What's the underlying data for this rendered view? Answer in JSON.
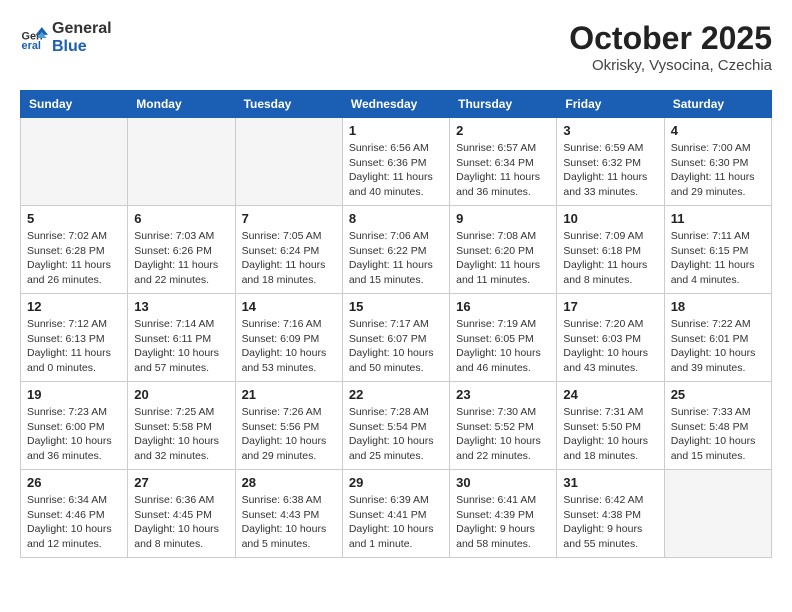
{
  "header": {
    "logo_line1": "General",
    "logo_line2": "Blue",
    "month": "October 2025",
    "location": "Okrisky, Vysocina, Czechia"
  },
  "weekdays": [
    "Sunday",
    "Monday",
    "Tuesday",
    "Wednesday",
    "Thursday",
    "Friday",
    "Saturday"
  ],
  "weeks": [
    [
      {
        "day": "",
        "info": ""
      },
      {
        "day": "",
        "info": ""
      },
      {
        "day": "",
        "info": ""
      },
      {
        "day": "1",
        "info": "Sunrise: 6:56 AM\nSunset: 6:36 PM\nDaylight: 11 hours and 40 minutes."
      },
      {
        "day": "2",
        "info": "Sunrise: 6:57 AM\nSunset: 6:34 PM\nDaylight: 11 hours and 36 minutes."
      },
      {
        "day": "3",
        "info": "Sunrise: 6:59 AM\nSunset: 6:32 PM\nDaylight: 11 hours and 33 minutes."
      },
      {
        "day": "4",
        "info": "Sunrise: 7:00 AM\nSunset: 6:30 PM\nDaylight: 11 hours and 29 minutes."
      }
    ],
    [
      {
        "day": "5",
        "info": "Sunrise: 7:02 AM\nSunset: 6:28 PM\nDaylight: 11 hours and 26 minutes."
      },
      {
        "day": "6",
        "info": "Sunrise: 7:03 AM\nSunset: 6:26 PM\nDaylight: 11 hours and 22 minutes."
      },
      {
        "day": "7",
        "info": "Sunrise: 7:05 AM\nSunset: 6:24 PM\nDaylight: 11 hours and 18 minutes."
      },
      {
        "day": "8",
        "info": "Sunrise: 7:06 AM\nSunset: 6:22 PM\nDaylight: 11 hours and 15 minutes."
      },
      {
        "day": "9",
        "info": "Sunrise: 7:08 AM\nSunset: 6:20 PM\nDaylight: 11 hours and 11 minutes."
      },
      {
        "day": "10",
        "info": "Sunrise: 7:09 AM\nSunset: 6:18 PM\nDaylight: 11 hours and 8 minutes."
      },
      {
        "day": "11",
        "info": "Sunrise: 7:11 AM\nSunset: 6:15 PM\nDaylight: 11 hours and 4 minutes."
      }
    ],
    [
      {
        "day": "12",
        "info": "Sunrise: 7:12 AM\nSunset: 6:13 PM\nDaylight: 11 hours and 0 minutes."
      },
      {
        "day": "13",
        "info": "Sunrise: 7:14 AM\nSunset: 6:11 PM\nDaylight: 10 hours and 57 minutes."
      },
      {
        "day": "14",
        "info": "Sunrise: 7:16 AM\nSunset: 6:09 PM\nDaylight: 10 hours and 53 minutes."
      },
      {
        "day": "15",
        "info": "Sunrise: 7:17 AM\nSunset: 6:07 PM\nDaylight: 10 hours and 50 minutes."
      },
      {
        "day": "16",
        "info": "Sunrise: 7:19 AM\nSunset: 6:05 PM\nDaylight: 10 hours and 46 minutes."
      },
      {
        "day": "17",
        "info": "Sunrise: 7:20 AM\nSunset: 6:03 PM\nDaylight: 10 hours and 43 minutes."
      },
      {
        "day": "18",
        "info": "Sunrise: 7:22 AM\nSunset: 6:01 PM\nDaylight: 10 hours and 39 minutes."
      }
    ],
    [
      {
        "day": "19",
        "info": "Sunrise: 7:23 AM\nSunset: 6:00 PM\nDaylight: 10 hours and 36 minutes."
      },
      {
        "day": "20",
        "info": "Sunrise: 7:25 AM\nSunset: 5:58 PM\nDaylight: 10 hours and 32 minutes."
      },
      {
        "day": "21",
        "info": "Sunrise: 7:26 AM\nSunset: 5:56 PM\nDaylight: 10 hours and 29 minutes."
      },
      {
        "day": "22",
        "info": "Sunrise: 7:28 AM\nSunset: 5:54 PM\nDaylight: 10 hours and 25 minutes."
      },
      {
        "day": "23",
        "info": "Sunrise: 7:30 AM\nSunset: 5:52 PM\nDaylight: 10 hours and 22 minutes."
      },
      {
        "day": "24",
        "info": "Sunrise: 7:31 AM\nSunset: 5:50 PM\nDaylight: 10 hours and 18 minutes."
      },
      {
        "day": "25",
        "info": "Sunrise: 7:33 AM\nSunset: 5:48 PM\nDaylight: 10 hours and 15 minutes."
      }
    ],
    [
      {
        "day": "26",
        "info": "Sunrise: 6:34 AM\nSunset: 4:46 PM\nDaylight: 10 hours and 12 minutes."
      },
      {
        "day": "27",
        "info": "Sunrise: 6:36 AM\nSunset: 4:45 PM\nDaylight: 10 hours and 8 minutes."
      },
      {
        "day": "28",
        "info": "Sunrise: 6:38 AM\nSunset: 4:43 PM\nDaylight: 10 hours and 5 minutes."
      },
      {
        "day": "29",
        "info": "Sunrise: 6:39 AM\nSunset: 4:41 PM\nDaylight: 10 hours and 1 minute."
      },
      {
        "day": "30",
        "info": "Sunrise: 6:41 AM\nSunset: 4:39 PM\nDaylight: 9 hours and 58 minutes."
      },
      {
        "day": "31",
        "info": "Sunrise: 6:42 AM\nSunset: 4:38 PM\nDaylight: 9 hours and 55 minutes."
      },
      {
        "day": "",
        "info": ""
      }
    ]
  ]
}
